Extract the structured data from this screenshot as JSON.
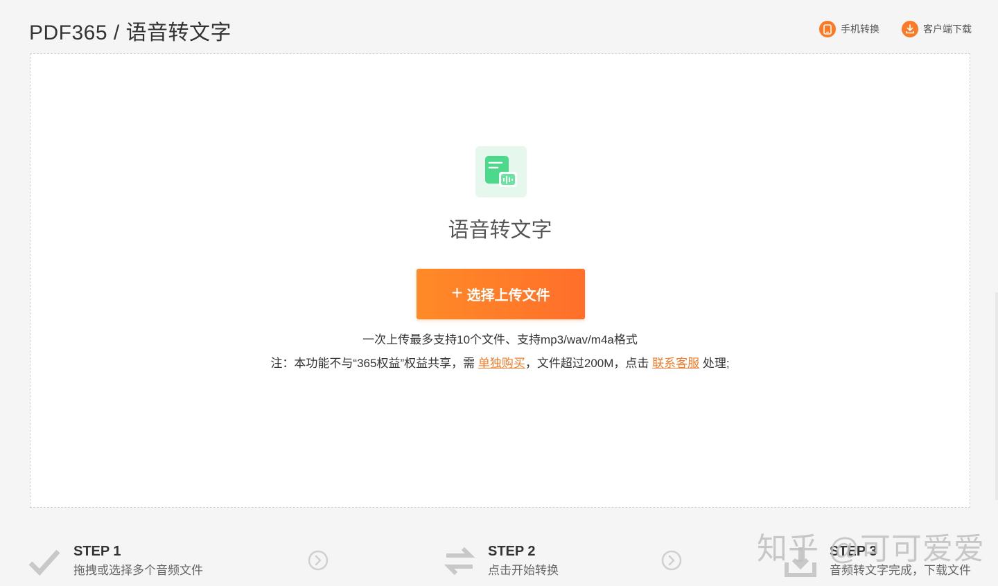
{
  "header": {
    "title": "PDF365 / 语音转文字",
    "actions": [
      {
        "label": "手机转换",
        "icon": "phone-icon"
      },
      {
        "label": "客户端下载",
        "icon": "download-icon"
      }
    ]
  },
  "upload": {
    "feature_icon": "audio-document-icon",
    "title": "语音转文字",
    "button_label": "选择上传文件",
    "hint": "一次上传最多支持10个文件、支持mp3/wav/m4a格式",
    "note": {
      "prefix": "注：本功能不与“365权益”权益共享，需 ",
      "link1": "单独购买",
      "middle": "，文件超过200M，点击 ",
      "link2": "联系客服",
      "suffix": " 处理;"
    }
  },
  "steps": [
    {
      "label": "STEP 1",
      "desc": "拖拽或选择多个音频文件",
      "icon": "checkmark-icon"
    },
    {
      "label": "STEP 2",
      "desc": "点击开始转换",
      "icon": "swap-arrows-icon"
    },
    {
      "label": "STEP 3",
      "desc": "音频转文字完成，下载文件",
      "icon": "download-tray-icon"
    }
  ],
  "watermark": "知乎 @可可爱爱",
  "colors": {
    "accent": "#ff7a28",
    "link": "#f27a2a",
    "feature_icon_green": "#4cd98c"
  }
}
